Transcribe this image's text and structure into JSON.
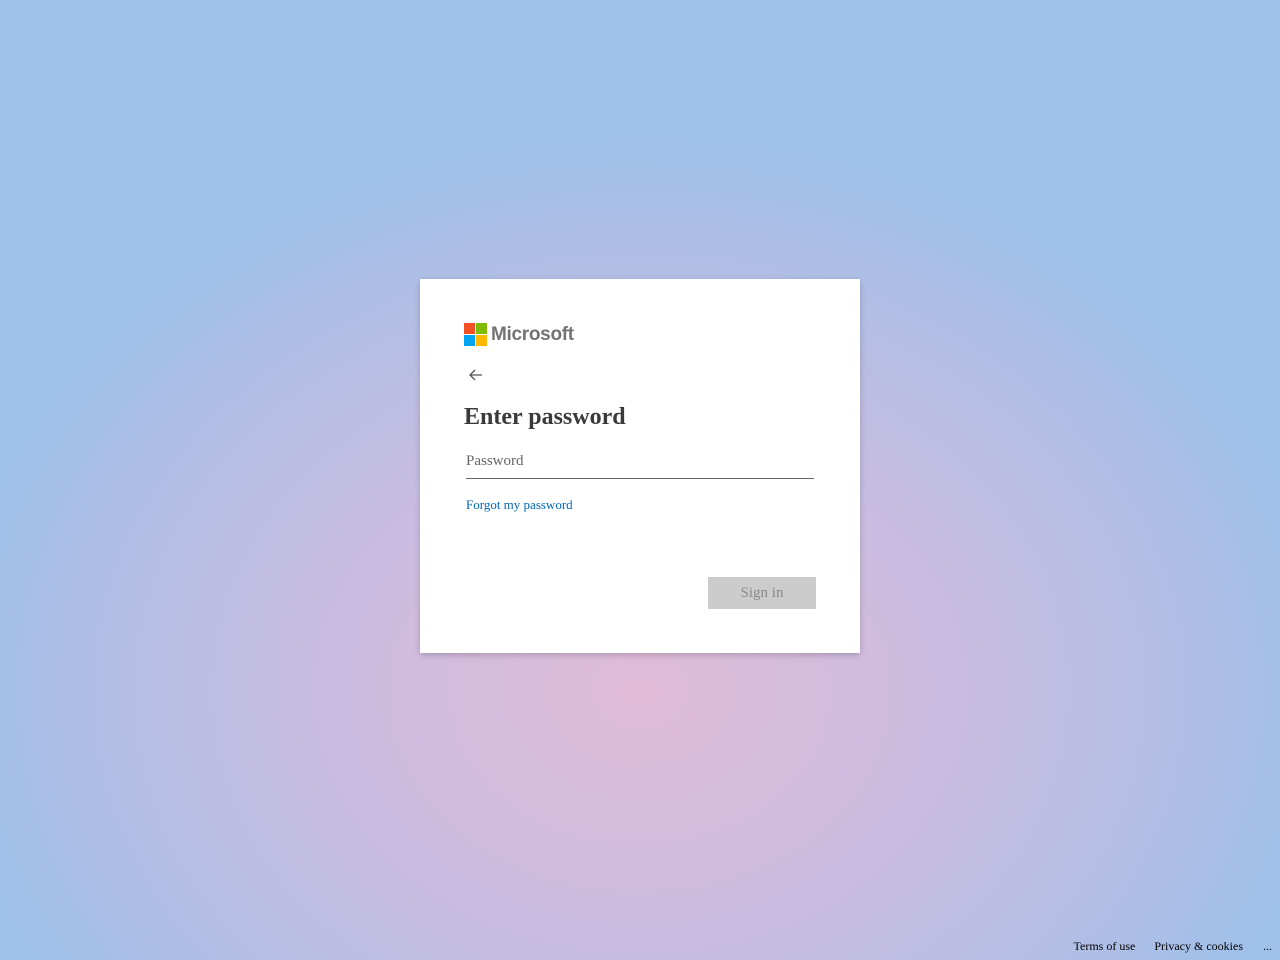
{
  "logo": {
    "text": "Microsoft",
    "colors": [
      "#f25022",
      "#7fba00",
      "#00a4ef",
      "#ffb900"
    ]
  },
  "card": {
    "back_icon": "arrow-left-icon",
    "title": "Enter password",
    "password": {
      "placeholder": "Password",
      "value": ""
    },
    "forgot_link": "Forgot my password",
    "signin_label": "Sign in"
  },
  "footer": {
    "terms": "Terms of use",
    "privacy": "Privacy & cookies",
    "more": "..."
  },
  "colors": {
    "link": "#0067b8",
    "button_disabled_bg": "#cccccc",
    "button_disabled_text": "#8a8a8a"
  }
}
